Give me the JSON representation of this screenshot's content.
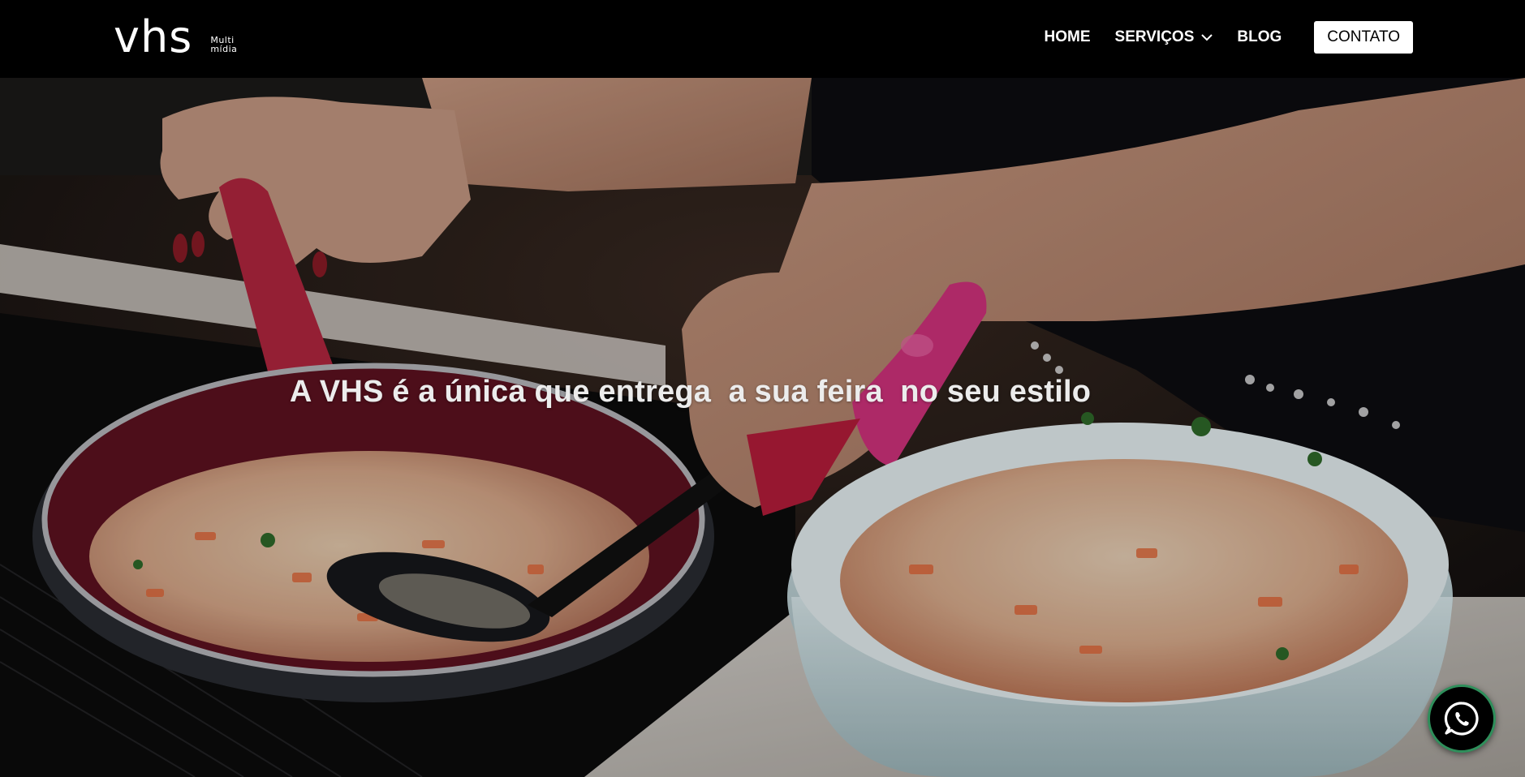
{
  "brand": {
    "logo_text": "vhs",
    "logo_sub_line1": "Multi",
    "logo_sub_line2": "mídia"
  },
  "nav": {
    "items": [
      {
        "label": "HOME"
      },
      {
        "label": "SERVIÇOS"
      },
      {
        "label": "BLOG"
      }
    ],
    "cta_label": "CONTATO"
  },
  "hero": {
    "headline": "A VHS é a única que entrega  a sua feira  no seu estilo"
  },
  "floating": {
    "icon": "whatsapp-icon"
  },
  "colors": {
    "header_bg": "#000000",
    "cta_bg": "#ffffff",
    "whatsapp_ring": "#2f8f5b"
  }
}
